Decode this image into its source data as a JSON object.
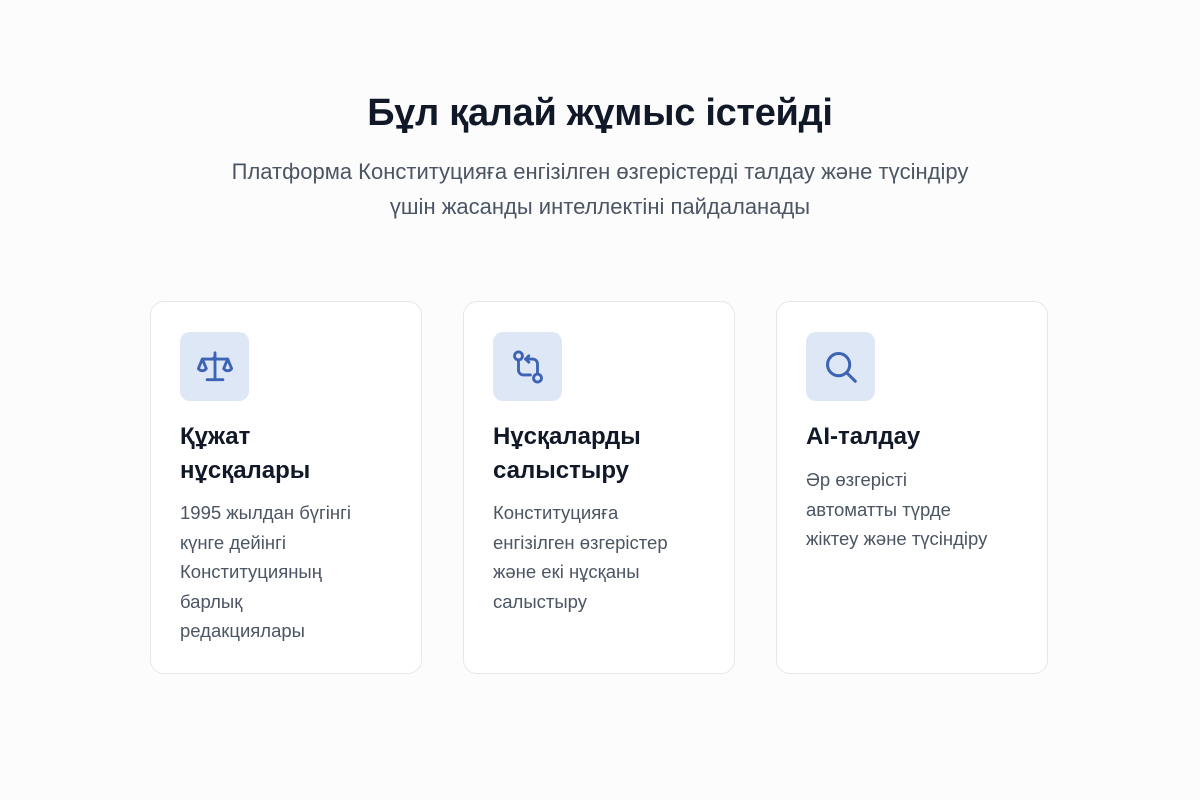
{
  "header": {
    "title": "Бұл қалай жұмыс істейді",
    "subtitle_lines": [
      "Платформа Конституцияға енгізілген өзгерістерді талдау және түсіндіру",
      "үшін жасанды интеллектіні пайдаланады"
    ]
  },
  "cards": [
    {
      "icon": "scales-icon",
      "title_lines": [
        "Құжат",
        "нұсқалары"
      ],
      "desc_lines": [
        "1995 жылдан бүгінгі",
        "күнге дейінгі",
        "Конституцияның",
        "барлық",
        "редакциялары"
      ]
    },
    {
      "icon": "compare-icon",
      "title_lines": [
        "Нұсқаларды",
        "салыстыру"
      ],
      "desc_lines": [
        "Конституцияға",
        "енгізілген өзгерістер",
        "және екі нұсқаны",
        "салыстыру"
      ]
    },
    {
      "icon": "search-icon",
      "title_lines": [
        "AI-талдау"
      ],
      "desc_lines": [
        "Әр өзгерісті",
        "автоматты түрде",
        "жіктеу және түсіндіру"
      ]
    }
  ],
  "colors": {
    "accent": "#3d63b5",
    "icon_bg": "#dde7f6",
    "title": "#111827",
    "body_text": "#4b5563",
    "card_border": "#e5e7eb"
  }
}
